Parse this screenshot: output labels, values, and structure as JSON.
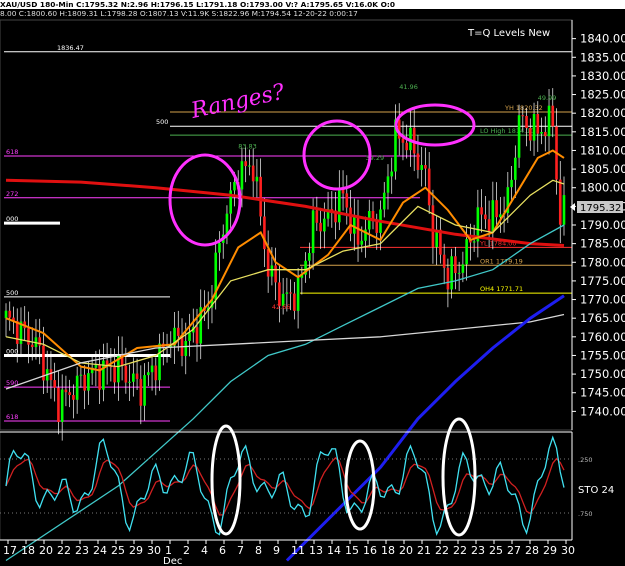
{
  "header": {
    "line1": "XAU/USD 180-Min C:1795.32 N:2.96 H:1796.15 L:1791.18 O:1793.00 V:? A:1795.65 V:16.0K O:0",
    "line2": "8.00 C:1800.60 H:1809.31 L:1798.28 O:1807.13 V:11.9K S:1822.96 M:1794.54 12-20-22 0:00:17"
  },
  "chart_title": "T=Q Levels New",
  "annotation_text": "Ranges?",
  "last_price_label": "1795.32",
  "sto_label": "STO 24",
  "colors": {
    "background": "#000000",
    "bull": "#00ff00",
    "bear": "#ff2020",
    "ma_red": "#e01010",
    "ma_orange": "#ff8c00",
    "ma_yellow": "#e8e060",
    "ma_cyan": "#40c8c8",
    "ma_blue": "#1e1ef0",
    "ma_white": "#d8d8d8",
    "annot_magenta": "#ff30ff",
    "osc_fast": "#40e0f0",
    "osc_slow": "#d02020"
  },
  "chart_data": {
    "type": "candlestick",
    "y_axis": {
      "min": 1735,
      "max": 1845,
      "ticks": [
        1740,
        1745,
        1750,
        1755,
        1760,
        1765,
        1770,
        1775,
        1780,
        1785,
        1790,
        1795,
        1800,
        1805,
        1810,
        1815,
        1820,
        1825,
        1830,
        1835,
        1840
      ]
    },
    "x_labels": [
      "17",
      "18",
      "20",
      "22",
      "23",
      "24",
      "25",
      "29",
      "30",
      "1",
      "2",
      "4",
      "6",
      "7",
      "8",
      "9",
      "11",
      "13",
      "14",
      "15",
      "16",
      "18",
      "20",
      "21",
      "22",
      "22",
      "23",
      "25",
      "27",
      "28",
      "29",
      "30"
    ],
    "x_month_label": "Dec",
    "levels": [
      {
        "name": "top",
        "label": "1836.47",
        "y": 1836.47,
        "color": "#ffffff"
      },
      {
        "name": "white-500",
        "label": "500",
        "y": 1816.5,
        "color": "#ffffff"
      },
      {
        "name": "lo-high",
        "label": "LO High 1814.10",
        "y": 1814.1,
        "color": "#4caf50"
      },
      {
        "name": "yh",
        "label": "YH 1820.32",
        "y": 1820.32,
        "color": "#d4a24c"
      },
      {
        "name": "magenta-618",
        "label": "618",
        "y": 1808.5,
        "color": "#ff40ff"
      },
      {
        "name": "magenta-272",
        "label": "272",
        "y": 1797.3,
        "color": "#ff40ff"
      },
      {
        "name": "white-000",
        "label": "000",
        "y": 1790.5,
        "color": "#ffffff"
      },
      {
        "name": "yl",
        "label": "YL 1784.00",
        "y": 1784.0,
        "color": "#ff3030"
      },
      {
        "name": "or1",
        "label": "OR1 1779.19",
        "y": 1779.19,
        "color": "#d4a24c"
      },
      {
        "name": "oh4",
        "label": "OH4 1771.71",
        "y": 1771.71,
        "color": "#ffff00"
      },
      {
        "name": "left-500",
        "label": "500",
        "y": 1770.7,
        "color": "#ffffff"
      },
      {
        "name": "left-000",
        "label": "000",
        "y": 1755.0,
        "color": "#ffffff"
      },
      {
        "name": "left-590",
        "label": "590",
        "y": 1746.5,
        "color": "#ff40ff"
      },
      {
        "name": "left-618",
        "label": "618",
        "y": 1737.4,
        "color": "#ff40ff"
      }
    ],
    "annotations": [
      {
        "label": "41.96",
        "x": 105,
        "y": 1826.5,
        "color": "#4caf50"
      },
      {
        "label": "49.99",
        "x": 142,
        "y": 1823.5,
        "color": "#4caf50"
      },
      {
        "label": "39.29",
        "x": 96,
        "y": 1807.5,
        "color": "#4caf50"
      },
      {
        "label": "42.66",
        "x": 71,
        "y": 1767.5,
        "color": "#ff3030"
      },
      {
        "label": "83.83",
        "x": 62,
        "y": 1810.5,
        "color": "#4caf50"
      }
    ],
    "series": [
      {
        "name": "ma-red",
        "color": "#e01010",
        "points": [
          [
            0,
            1802
          ],
          [
            20,
            1801.5
          ],
          [
            40,
            1800
          ],
          [
            60,
            1798
          ],
          [
            80,
            1795
          ],
          [
            100,
            1791
          ],
          [
            120,
            1787.5
          ],
          [
            140,
            1785
          ],
          [
            149,
            1784.5
          ]
        ]
      },
      {
        "name": "ma-orange",
        "color": "#ff8c00",
        "points": [
          [
            0,
            1765
          ],
          [
            10,
            1761
          ],
          [
            20,
            1752
          ],
          [
            25,
            1751
          ],
          [
            35,
            1757
          ],
          [
            45,
            1758
          ],
          [
            55,
            1770
          ],
          [
            62,
            1784
          ],
          [
            68,
            1788
          ],
          [
            72,
            1780
          ],
          [
            78,
            1776
          ],
          [
            86,
            1782
          ],
          [
            92,
            1790
          ],
          [
            100,
            1786
          ],
          [
            106,
            1796
          ],
          [
            112,
            1800
          ],
          [
            118,
            1794
          ],
          [
            124,
            1786
          ],
          [
            130,
            1788
          ],
          [
            136,
            1798
          ],
          [
            142,
            1808
          ],
          [
            146,
            1810
          ],
          [
            149,
            1808
          ]
        ]
      },
      {
        "name": "ma-yellow",
        "color": "#e8e060",
        "points": [
          [
            0,
            1760
          ],
          [
            10,
            1758
          ],
          [
            20,
            1753
          ],
          [
            30,
            1752
          ],
          [
            40,
            1755
          ],
          [
            50,
            1762
          ],
          [
            60,
            1775
          ],
          [
            70,
            1778
          ],
          [
            80,
            1778
          ],
          [
            90,
            1783
          ],
          [
            100,
            1785
          ],
          [
            110,
            1795
          ],
          [
            120,
            1790
          ],
          [
            130,
            1788
          ],
          [
            140,
            1798
          ],
          [
            146,
            1802
          ],
          [
            149,
            1801
          ]
        ]
      },
      {
        "name": "ma-cyan",
        "color": "#40c8c8",
        "points": [
          [
            0,
            1700
          ],
          [
            30,
            1720
          ],
          [
            50,
            1738
          ],
          [
            60,
            1748
          ],
          [
            70,
            1755
          ],
          [
            80,
            1758
          ],
          [
            90,
            1763
          ],
          [
            100,
            1768
          ],
          [
            110,
            1773
          ],
          [
            120,
            1775
          ],
          [
            130,
            1778
          ],
          [
            140,
            1785
          ],
          [
            149,
            1790
          ]
        ]
      },
      {
        "name": "ma-white",
        "color": "#d8d8d8",
        "points": [
          [
            0,
            1746
          ],
          [
            20,
            1753
          ],
          [
            40,
            1757
          ],
          [
            60,
            1758
          ],
          [
            80,
            1759
          ],
          [
            100,
            1760
          ],
          [
            120,
            1762
          ],
          [
            140,
            1764
          ],
          [
            149,
            1766
          ]
        ]
      },
      {
        "name": "ma-blue",
        "color": "#1e1ef0",
        "points": [
          [
            75,
            1700
          ],
          [
            90,
            1715
          ],
          [
            100,
            1725
          ],
          [
            110,
            1738
          ],
          [
            120,
            1748
          ],
          [
            130,
            1757
          ],
          [
            140,
            1765
          ],
          [
            149,
            1771
          ]
        ]
      }
    ],
    "oscillator": {
      "range": [
        0,
        100
      ],
      "levels": [
        {
          "label": ".250",
          "y": 75
        },
        {
          "label": ".750",
          "y": 25
        }
      ]
    }
  }
}
